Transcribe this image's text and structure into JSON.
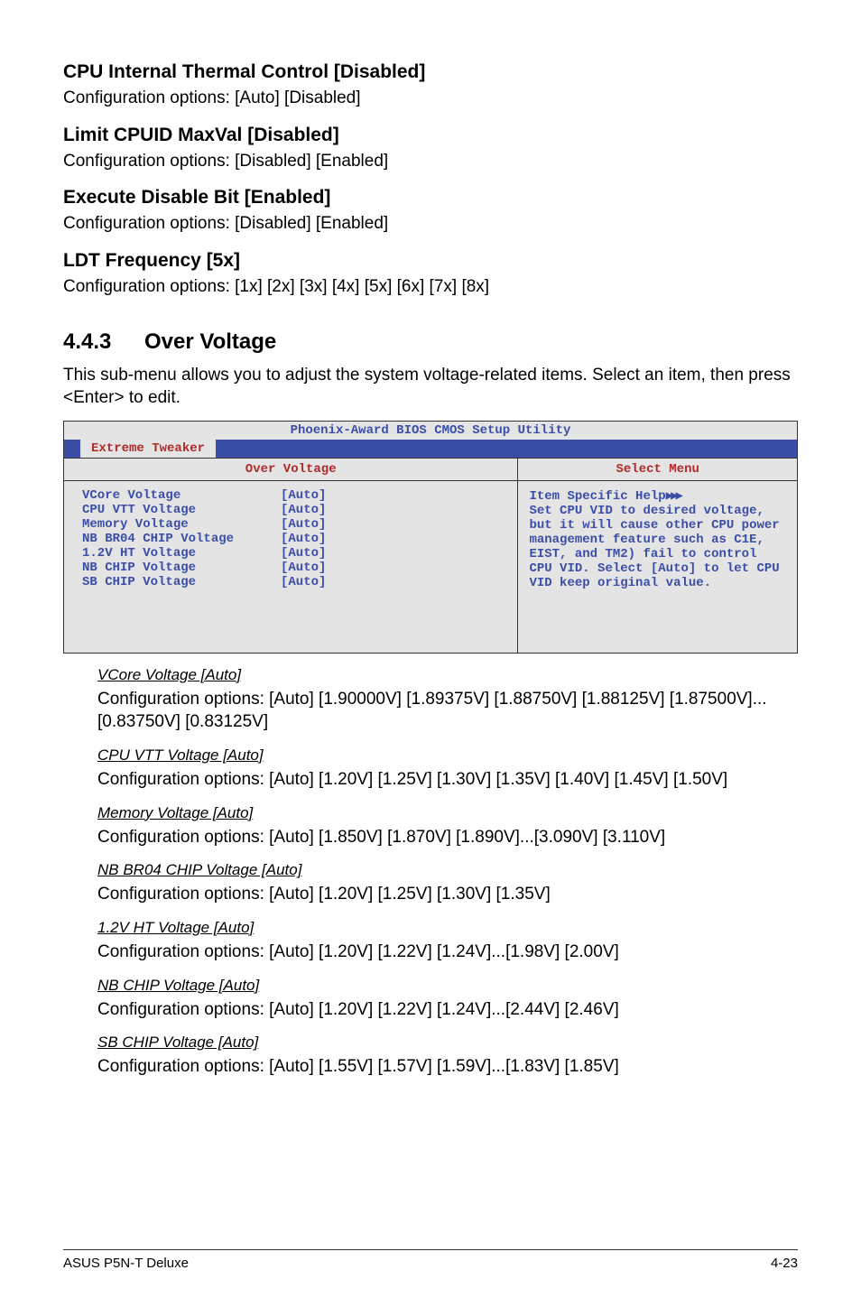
{
  "sections": {
    "s1": {
      "title": "CPU Internal Thermal Control [Disabled]",
      "text": "Configuration options: [Auto] [Disabled]"
    },
    "s2": {
      "title": "Limit CPUID MaxVal [Disabled]",
      "text": "Configuration options: [Disabled] [Enabled]"
    },
    "s3": {
      "title": "Execute Disable Bit [Enabled]",
      "text": "Configuration options: [Disabled] [Enabled]"
    },
    "s4": {
      "title": "LDT Frequency [5x]",
      "text": "Configuration options: [1x] [2x] [3x] [4x] [5x] [6x] [7x] [8x]"
    }
  },
  "major": {
    "num": "4.4.3",
    "title": "Over Voltage",
    "intro": "This sub-menu allows you to adjust the system voltage-related items. Select an item, then press <Enter> to edit."
  },
  "bios": {
    "title": "Phoenix-Award BIOS CMOS Setup Utility",
    "tab": "Extreme Tweaker",
    "left_header": "Over Voltage",
    "right_header": "Select Menu",
    "rows": [
      {
        "label": "VCore Voltage",
        "val": "[Auto]"
      },
      {
        "label": "CPU VTT Voltage",
        "val": "[Auto]"
      },
      {
        "label": "Memory Voltage",
        "val": "[Auto]"
      },
      {
        "label": "NB BR04 CHIP Voltage",
        "val": "[Auto]"
      },
      {
        "label": "1.2V HT Voltage",
        "val": "[Auto]"
      },
      {
        "label": "NB CHIP Voltage",
        "val": "[Auto]"
      },
      {
        "label": "SB CHIP Voltage",
        "val": "[Auto]"
      }
    ],
    "help_line1": "Item Specific Help",
    "help_rest": "Set CPU VID to desired voltage, but it will cause other CPU power management feature such as C1E, EIST, and TM2) fail to control CPU VID. Select [Auto] to let CPU VID keep original value."
  },
  "items": {
    "i1": {
      "head": "VCore Voltage [Auto]",
      "text": "Configuration options: [Auto] [1.90000V] [1.89375V] [1.88750V] [1.88125V] [1.87500V]...[0.83750V] [0.83125V]"
    },
    "i2": {
      "head": "CPU VTT Voltage [Auto]",
      "text": "Configuration options: [Auto] [1.20V] [1.25V] [1.30V] [1.35V] [1.40V] [1.45V] [1.50V]"
    },
    "i3": {
      "head": "Memory Voltage [Auto]",
      "text": "Configuration options: [Auto] [1.850V] [1.870V] [1.890V]...[3.090V] [3.110V]"
    },
    "i4": {
      "head": "NB BR04 CHIP Voltage [Auto]",
      "text": "Configuration options: [Auto] [1.20V] [1.25V] [1.30V] [1.35V]"
    },
    "i5": {
      "head": "1.2V HT Voltage [Auto]",
      "text": "Configuration options: [Auto] [1.20V] [1.22V] [1.24V]...[1.98V] [2.00V]"
    },
    "i6": {
      "head": "NB CHIP Voltage [Auto]",
      "text": "Configuration options: [Auto] [1.20V] [1.22V] [1.24V]...[2.44V] [2.46V]"
    },
    "i7": {
      "head": "SB CHIP Voltage [Auto]",
      "text": "Configuration options: [Auto] [1.55V] [1.57V] [1.59V]...[1.83V] [1.85V]"
    }
  },
  "footer": {
    "left": "ASUS P5N-T Deluxe",
    "right": "4-23"
  }
}
